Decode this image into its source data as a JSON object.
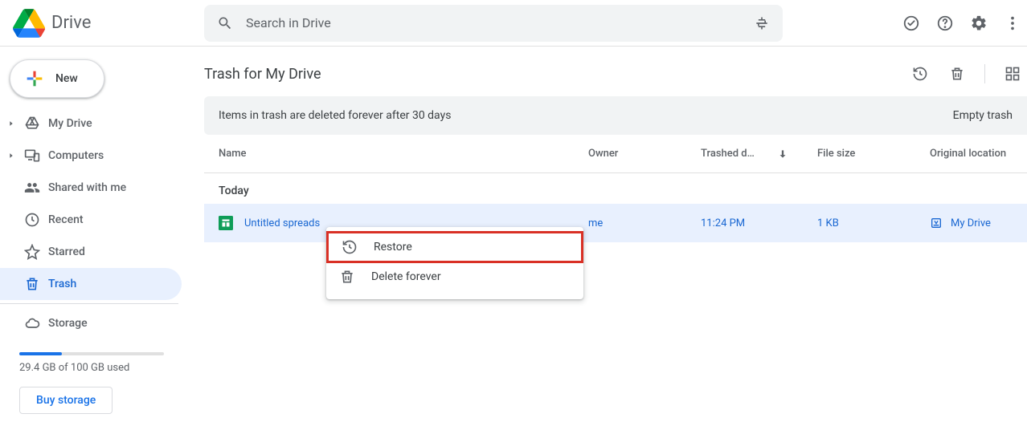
{
  "app": {
    "title": "Drive"
  },
  "search": {
    "placeholder": "Search in Drive"
  },
  "new_button": {
    "label": "New"
  },
  "sidebar": {
    "items": [
      {
        "id": "my-drive",
        "label": "My Drive",
        "expandable": true
      },
      {
        "id": "computers",
        "label": "Computers",
        "expandable": true
      },
      {
        "id": "shared",
        "label": "Shared with me",
        "expandable": false
      },
      {
        "id": "recent",
        "label": "Recent",
        "expandable": false
      },
      {
        "id": "starred",
        "label": "Starred",
        "expandable": false
      },
      {
        "id": "trash",
        "label": "Trash",
        "expandable": false,
        "active": true
      }
    ],
    "storage": {
      "label": "Storage",
      "used_text": "29.4 GB of 100 GB used",
      "percent": 29.4,
      "buy_label": "Buy storage"
    }
  },
  "page": {
    "title": "Trash for My Drive",
    "banner": "Items in trash are deleted forever after 30 days",
    "empty_trash_label": "Empty trash"
  },
  "columns": {
    "name": "Name",
    "owner": "Owner",
    "trashed": "Trashed d…",
    "size": "File size",
    "location": "Original location"
  },
  "group_label": "Today",
  "file": {
    "name": "Untitled spreads",
    "owner": "me",
    "trashed": "11:24 PM",
    "size": "1 KB",
    "location": "My Drive"
  },
  "context_menu": {
    "restore": "Restore",
    "delete": "Delete forever"
  }
}
